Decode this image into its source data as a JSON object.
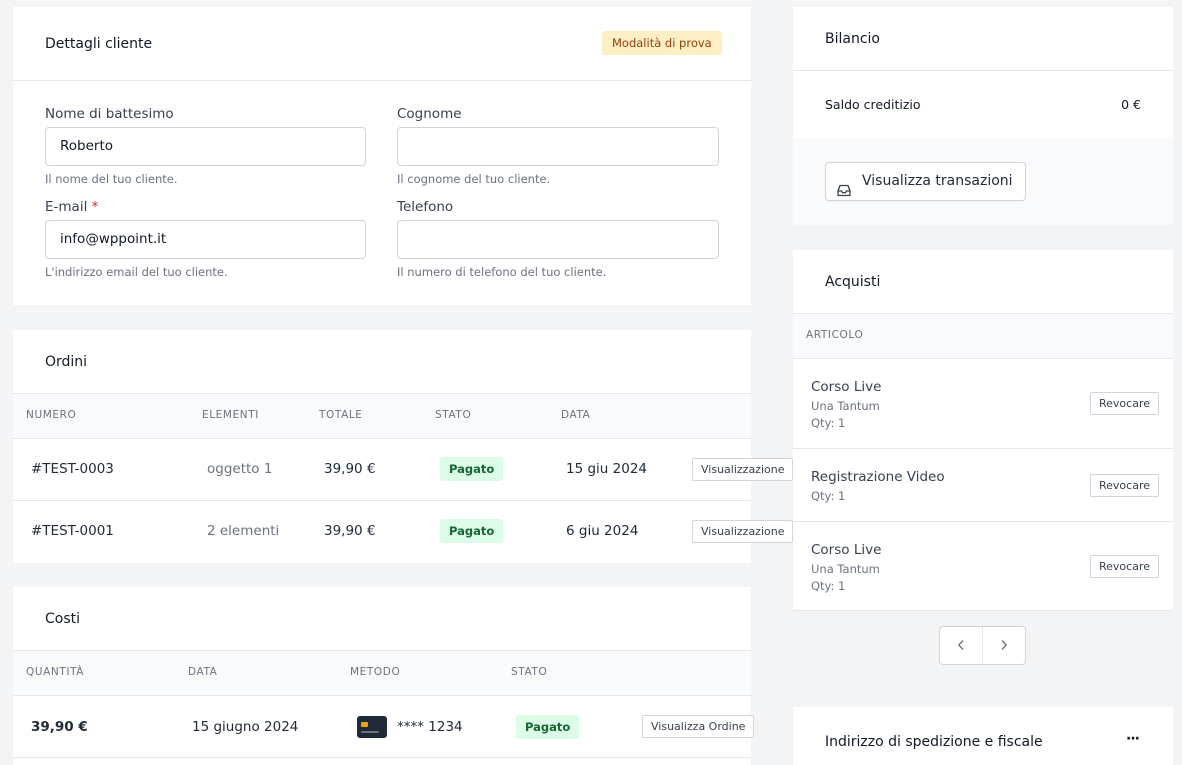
{
  "customer": {
    "title": "Dettagli cliente",
    "badge": "Modalità di prova",
    "first_name_label": "Nome di battesimo",
    "first_name_value": "Roberto",
    "first_name_help": "Il nome del tuo cliente.",
    "last_name_label": "Cognome",
    "last_name_value": "",
    "last_name_help": "Il cognome del tuo cliente.",
    "email_label": "E-mail",
    "email_required": "*",
    "email_value": "info@wppoint.it",
    "email_help": "L'indirizzo email del tuo cliente.",
    "phone_label": "Telefono",
    "phone_value": "",
    "phone_help": "Il numero di telefono del tuo cliente."
  },
  "orders": {
    "title": "Ordini",
    "headers": [
      "Numero",
      "Elementi",
      "Totale",
      "Stato",
      "Data"
    ],
    "rows": [
      {
        "number": "#TEST-0003",
        "items": "oggetto 1",
        "total": "39,90 €",
        "status": "Pagato",
        "date": "15 giu 2024",
        "action": "Visualizzazione"
      },
      {
        "number": "#TEST-0001",
        "items": "2 elementi",
        "total": "39,90 €",
        "status": "Pagato",
        "date": "6 giu 2024",
        "action": "Visualizzazione"
      }
    ]
  },
  "charges": {
    "title": "Costi",
    "headers": [
      "Quantità",
      "Data",
      "Metodo",
      "Stato"
    ],
    "rows": [
      {
        "amount": "39,90 €",
        "date": "15 giugno 2024",
        "method": "**** 1234",
        "status": "Pagato",
        "action": "Visualizza Ordine"
      }
    ]
  },
  "balance": {
    "title": "Bilancio",
    "credit_label": "Saldo creditizio",
    "credit_value": "0 €",
    "transactions_button": "Visualizza transazioni"
  },
  "purchases": {
    "title": "Acquisti",
    "header": "Articolo",
    "items": [
      {
        "name": "Corso Live",
        "type": "Una Tantum",
        "qty": "Qty: 1",
        "action": "Revocare"
      },
      {
        "name": "Registrazione Video",
        "type": "",
        "qty": "Qty: 1",
        "action": "Revocare"
      },
      {
        "name": "Corso Live",
        "type": "Una Tantum",
        "qty": "Qty: 1",
        "action": "Revocare"
      }
    ]
  },
  "shipping": {
    "title": "Indirizzo di spedizione e fiscale",
    "menu": "···"
  },
  "icons": {
    "transactions": "inbox-icon",
    "prev": "chevron-left-icon",
    "next": "chevron-right-icon",
    "card": "credit-card-icon",
    "menu": "more-icon"
  },
  "colors": {
    "accent_badge": "#fdefc3",
    "paid": "#dcfce7",
    "required": "#dc2626"
  }
}
